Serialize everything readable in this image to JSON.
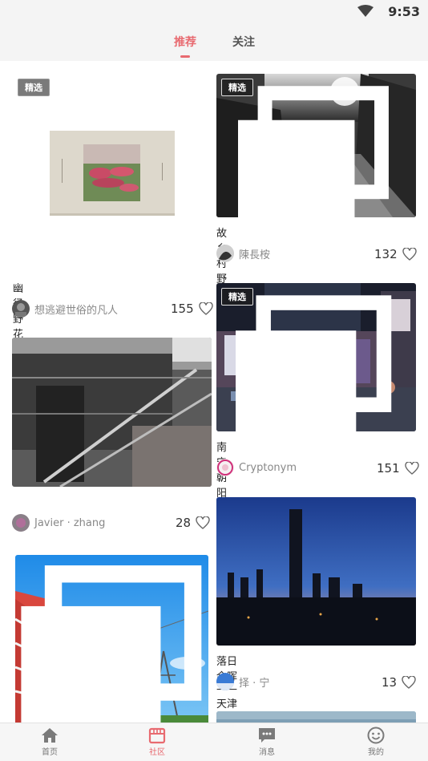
{
  "status": {
    "time": "9:53"
  },
  "tabs": {
    "recommend": "推荐",
    "follow": "关注"
  },
  "badge": "精选",
  "posts": [
    {
      "title": "幽径野花",
      "author": "想逃避世俗的凡人",
      "likes": "155"
    },
    {
      "title": "故乡村野",
      "author": "陳長桉",
      "likes": "132"
    },
    {
      "title": "",
      "author": "Javier · zhang",
      "likes": "28"
    },
    {
      "title": "南宁朝阳广场",
      "author": "Cryptonym",
      "likes": "151"
    },
    {
      "title": "落日余晖——天津",
      "author": "择 · 宁",
      "likes": "13"
    }
  ],
  "nav": {
    "home": "首页",
    "community": "社区",
    "messages": "消息",
    "mine": "我的"
  },
  "colors": {
    "accent": "#e86a70"
  }
}
